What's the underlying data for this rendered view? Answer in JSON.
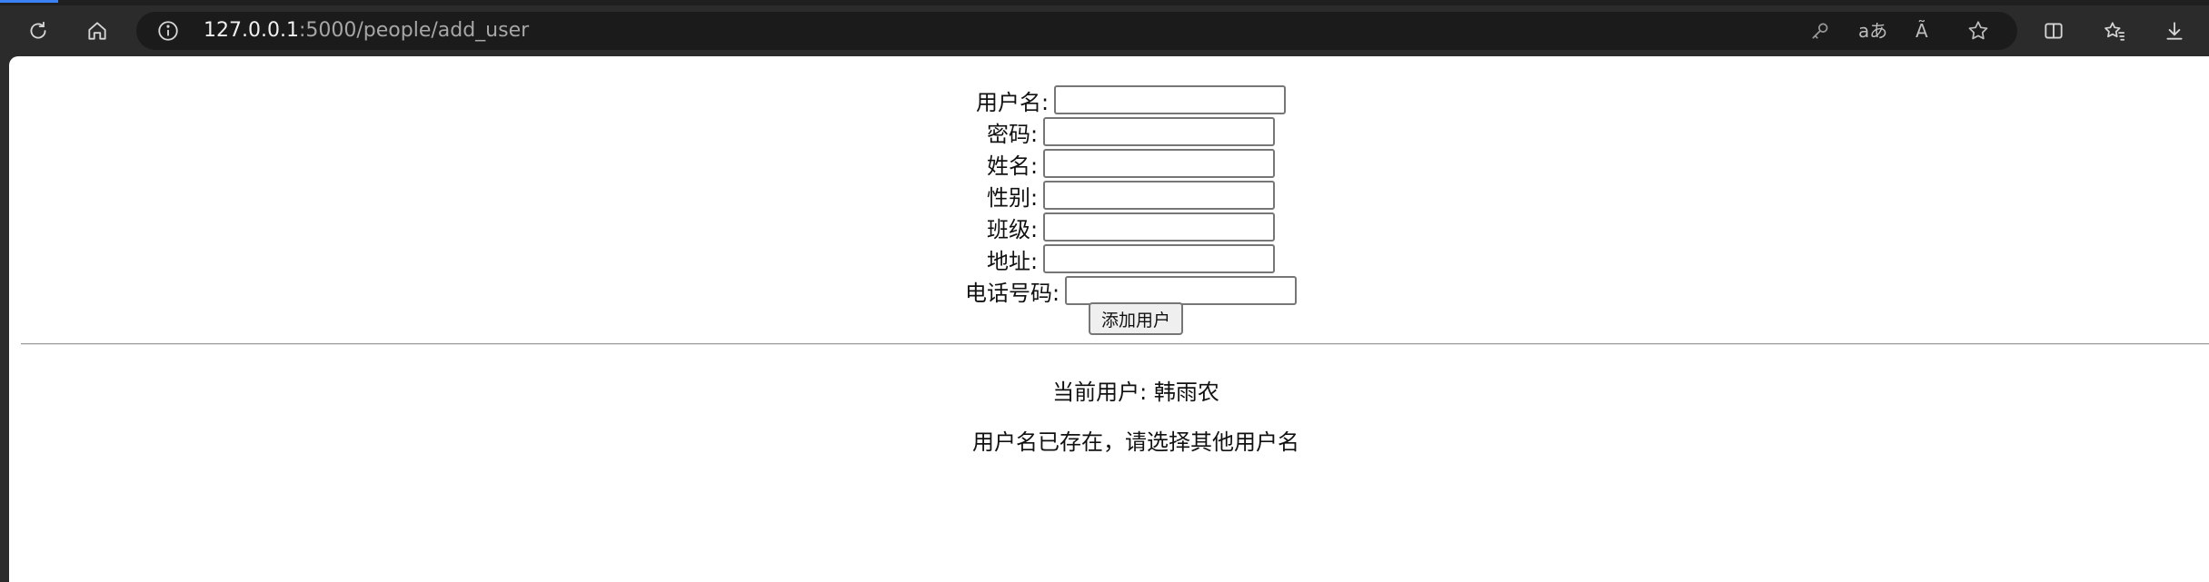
{
  "browser": {
    "url_host": "127.0.0.1",
    "url_path": ":5000/people/add_user",
    "icons": {
      "refresh": "refresh-icon",
      "home": "home-icon",
      "info": "info-icon",
      "key": "key-icon",
      "translate": "translate-icon",
      "read_aloud": "read-aloud-icon",
      "favorite": "star-icon",
      "split": "split-screen-icon",
      "favorites": "favorites-icon",
      "downloads": "download-icon"
    },
    "translate_glyph": "aあ",
    "read_aloud_glyph": "Ã"
  },
  "form": {
    "fields": [
      {
        "label": "用户名:",
        "value": "",
        "placeholder": ""
      },
      {
        "label": "密码:",
        "value": "",
        "placeholder": ""
      },
      {
        "label": "姓名:",
        "value": "",
        "placeholder": ""
      },
      {
        "label": "性别:",
        "value": "",
        "placeholder": ""
      },
      {
        "label": "班级:",
        "value": "",
        "placeholder": ""
      },
      {
        "label": "地址:",
        "value": "",
        "placeholder": ""
      },
      {
        "label": "电话号码:",
        "value": "",
        "placeholder": ""
      }
    ],
    "submit_label": "添加用户"
  },
  "status": {
    "current_user": "当前用户: 韩雨农",
    "message": "用户名已存在，请选择其他用户名"
  },
  "colors": {
    "chrome_bg": "#2b2b2b",
    "address_bg": "#1b1b1b",
    "page_bg": "#ffffff"
  }
}
